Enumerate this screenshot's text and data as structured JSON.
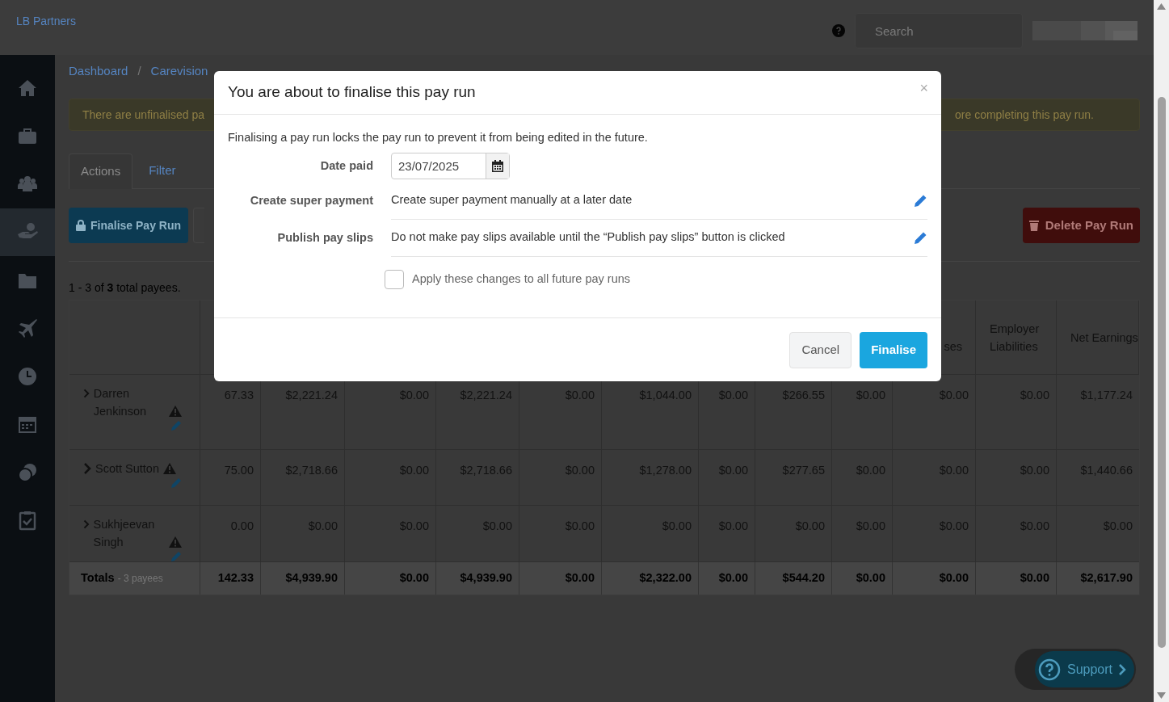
{
  "app": {
    "brand": "LB Partners",
    "search": {
      "placeholder": "Search"
    }
  },
  "sidebar": {
    "items": [
      {
        "kind": "home",
        "selected": false
      },
      {
        "kind": "briefcase",
        "selected": false
      },
      {
        "kind": "people",
        "selected": false
      },
      {
        "kind": "hand",
        "selected": true
      },
      {
        "kind": "folder",
        "selected": false
      },
      {
        "kind": "plane",
        "selected": false
      },
      {
        "kind": "clock",
        "selected": false
      },
      {
        "kind": "calendar",
        "selected": false
      },
      {
        "kind": "coins",
        "selected": false
      },
      {
        "kind": "clipboard",
        "selected": false
      }
    ]
  },
  "breadcrumb": [
    {
      "label": "Dashboard",
      "separator": "/"
    },
    {
      "label": "Carevision"
    }
  ],
  "alert": {
    "text_start": "There are unfinalised pa",
    "text_end": "ore completing this pay run."
  },
  "tabs": [
    {
      "label": "Actions",
      "selected": true
    },
    {
      "label": "Filter",
      "selected": false
    }
  ],
  "actions": {
    "finalise": "Finalise Pay Run",
    "delete": "Delete Pay Run"
  },
  "summary": "1 - 3 of **3** total payees.",
  "table": {
    "header": {
      "column_11": "ses",
      "column_12": "Employer Liabilities",
      "column_13": "Net Earnings"
    },
    "rows": [
      {
        "name": "Darren Jenkinson",
        "warning": true,
        "cells": [
          "67.33",
          "$2,221.24",
          "$0.00",
          "$2,221.24",
          "$0.00",
          "$1,044.00",
          "$0.00",
          "$266.55",
          "$0.00",
          "$0.00",
          "$0.00",
          "$1,177.24"
        ]
      },
      {
        "name": "Scott Sutton",
        "warning": true,
        "cells": [
          "75.00",
          "$2,718.66",
          "$0.00",
          "$2,718.66",
          "$0.00",
          "$1,278.00",
          "$0.00",
          "$277.65",
          "$0.00",
          "$0.00",
          "$0.00",
          "$1,440.66"
        ]
      },
      {
        "name": "Sukhjeevan Singh",
        "warning": true,
        "cells": [
          "0.00",
          "$0.00",
          "$0.00",
          "$0.00",
          "$0.00",
          "$0.00",
          "$0.00",
          "$0.00",
          "$0.00",
          "$0.00",
          "$0.00",
          "$0.00"
        ]
      }
    ],
    "totals": {
      "label": "Totals",
      "note": "- 3 payees",
      "cells": [
        "142.33",
        "$4,939.90",
        "$0.00",
        "$4,939.90",
        "$0.00",
        "$2,322.00",
        "$0.00",
        "$544.20",
        "$0.00",
        "$0.00",
        "$0.00",
        "$2,617.90"
      ]
    }
  },
  "modal": {
    "title": "You are about to finalise this pay run",
    "close": "×",
    "description": "Finalising a pay run locks the pay run to prevent it from being edited in the future.",
    "fields": [
      {
        "kind": "date",
        "label": "Date paid",
        "value": "23/07/2025"
      },
      {
        "kind": "setting",
        "label": "Create super payment",
        "value": "Create super payment manually at a later date"
      },
      {
        "kind": "setting",
        "label": "Publish pay slips",
        "value": "Do not make pay slips available until the “Publish pay slips” button is clicked"
      }
    ],
    "apply_all": {
      "label": "Apply these changes to all future pay runs",
      "checked": false
    },
    "cancel": "Cancel",
    "confirm": "Finalise"
  },
  "support": {
    "label": "Support"
  }
}
